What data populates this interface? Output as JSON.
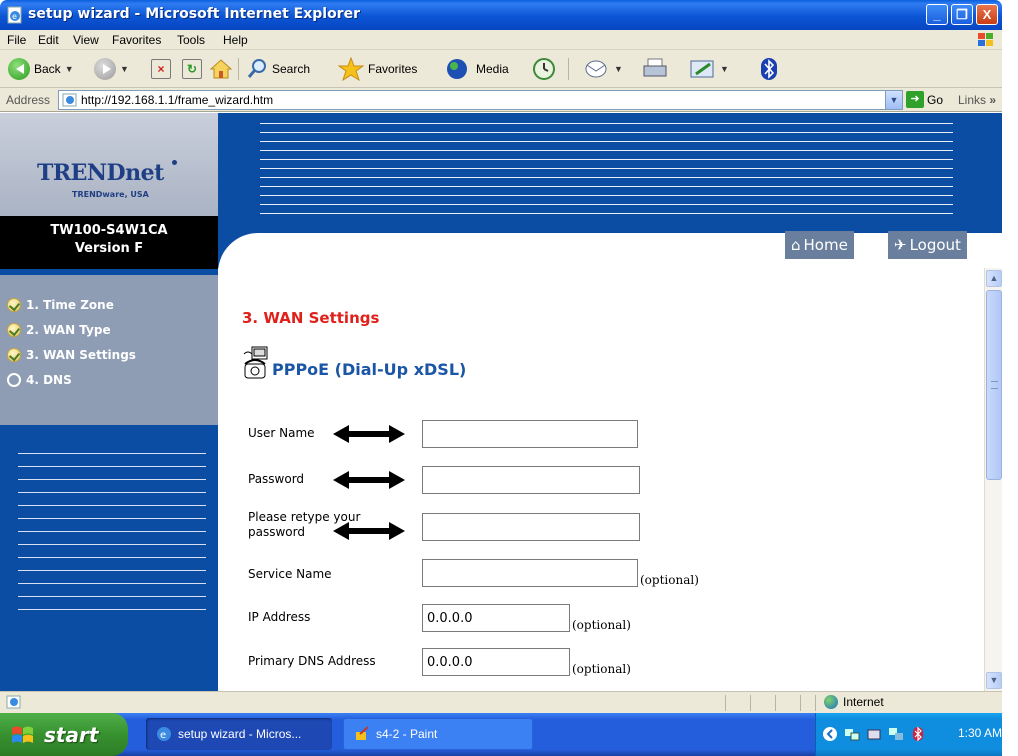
{
  "window": {
    "title": "setup wizard - Microsoft Internet Explorer",
    "minimize": "_",
    "maximize": "❐",
    "close": "X"
  },
  "menu": [
    "File",
    "Edit",
    "View",
    "Favorites",
    "Tools",
    "Help"
  ],
  "toolbar": {
    "back_label": "Back",
    "search_label": "Search",
    "favorites_label": "Favorites",
    "media_label": "Media"
  },
  "address": {
    "label": "Address",
    "url": "http://192.168.1.1/frame_wizard.htm",
    "go_label": "Go",
    "links_label": "Links"
  },
  "router": {
    "brand": "TRENDnet",
    "brand_sub": "TRENDware, USA",
    "model": "TW100-S4W1CA",
    "version": "Version F",
    "home_label": "Home",
    "logout_label": "Logout"
  },
  "steps": [
    {
      "label": "1. Time Zone",
      "done": true
    },
    {
      "label": "2. WAN Type",
      "done": true
    },
    {
      "label": "3. WAN Settings",
      "done": true
    },
    {
      "label": "4. DNS",
      "done": false
    }
  ],
  "form": {
    "title": "3. WAN Settings",
    "subtitle": "PPPoE (Dial-Up xDSL)",
    "user_name_label": "User Name",
    "user_name_value": "",
    "password_label": "Password",
    "password_value": "",
    "retype_label_line1": "Please retype your",
    "retype_label_line2": "password",
    "retype_value": "",
    "service_name_label": "Service Name",
    "service_name_value": "",
    "ip_address_label": "IP Address",
    "ip_address_value": "0.0.0.0",
    "primary_dns_label": "Primary DNS Address",
    "primary_dns_value": "0.0.0.0",
    "optional_text": "(optional)"
  },
  "status": {
    "zone": "Internet"
  },
  "taskbar": {
    "start_label": "start",
    "tasks": [
      {
        "label": "setup wizard - Micros...",
        "active": true
      },
      {
        "label": "s4-2 - Paint",
        "active": false
      }
    ],
    "clock": "1:30 AM"
  },
  "colors": {
    "router_blue": "#0b4da2",
    "title_red": "#e0201a",
    "subtitle_blue": "#1a56a5"
  }
}
